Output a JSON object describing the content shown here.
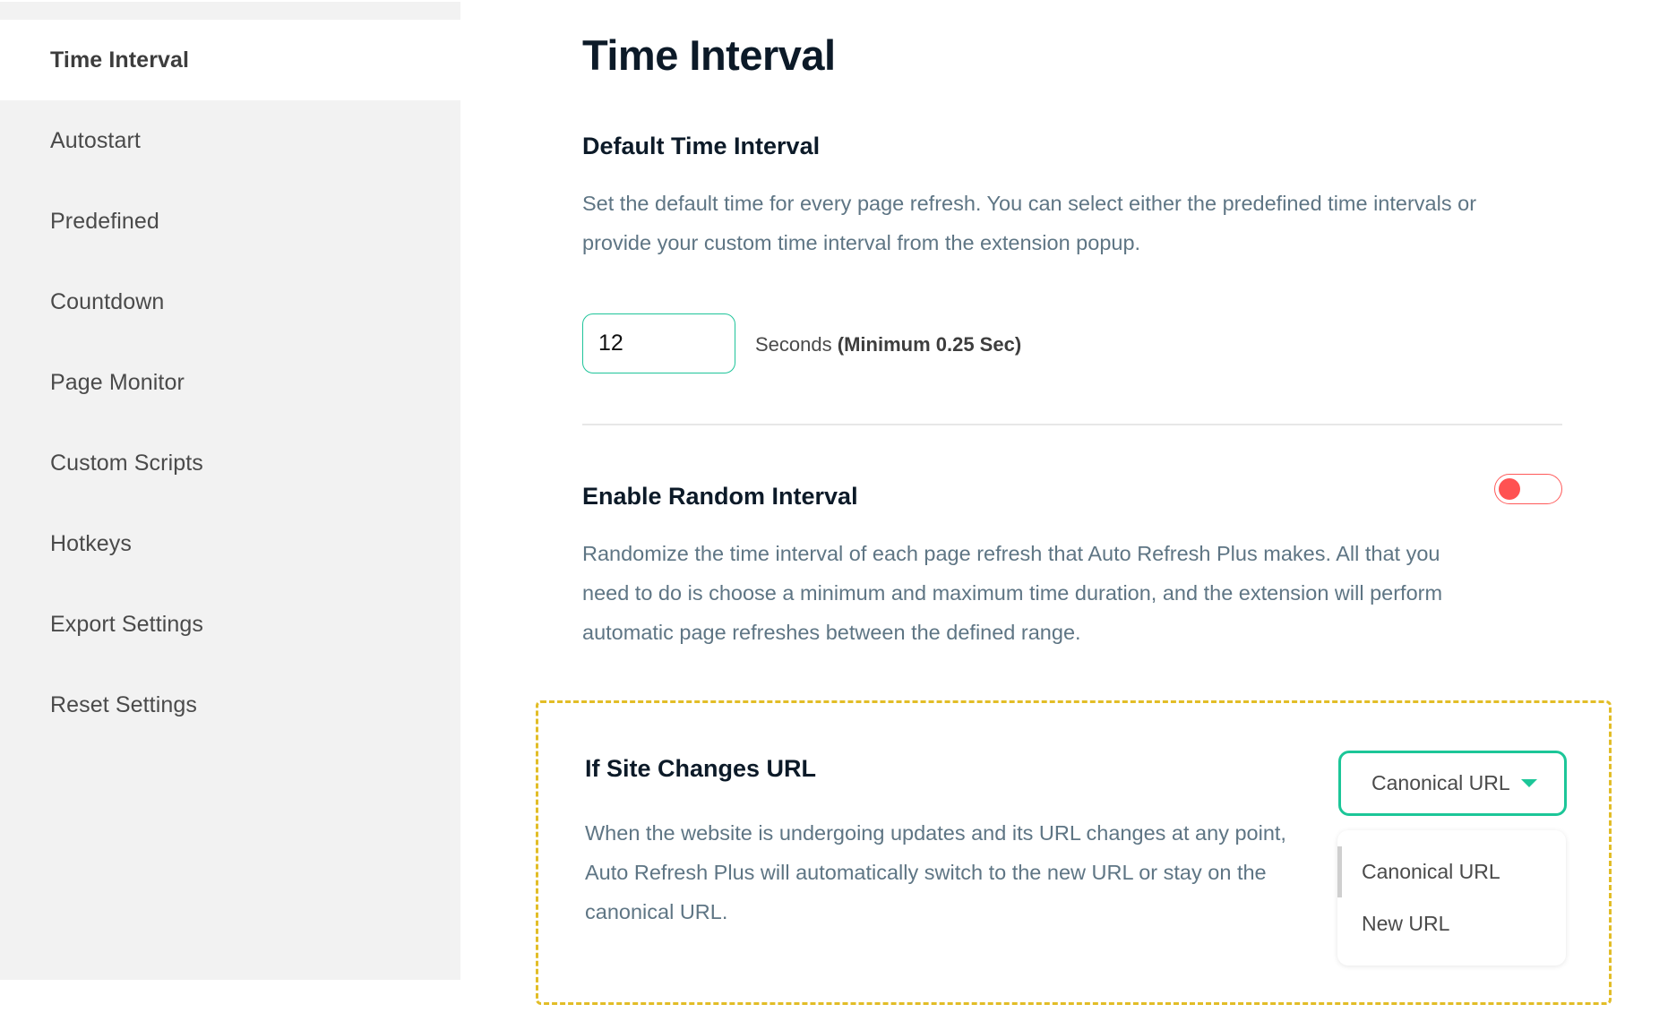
{
  "sidebar": {
    "items": [
      {
        "label": "Time Interval",
        "active": true
      },
      {
        "label": "Autostart",
        "active": false
      },
      {
        "label": "Predefined",
        "active": false
      },
      {
        "label": "Countdown",
        "active": false
      },
      {
        "label": "Page Monitor",
        "active": false
      },
      {
        "label": "Custom Scripts",
        "active": false
      },
      {
        "label": "Hotkeys",
        "active": false
      },
      {
        "label": "Export Settings",
        "active": false
      },
      {
        "label": "Reset Settings",
        "active": false
      }
    ]
  },
  "main": {
    "title": "Time Interval",
    "default_interval": {
      "heading": "Default Time Interval",
      "description": "Set the default time for every page refresh. You can select either the predefined time intervals or provide your custom time interval from the extension popup.",
      "input_value": "12",
      "unit_label": "Seconds",
      "unit_note": "(Minimum 0.25 Sec)"
    },
    "random_interval": {
      "heading": "Enable Random Interval",
      "description": "Randomize the time interval of each page refresh that Auto Refresh Plus makes. All that you need to do is choose a minimum and maximum time duration, and the extension will perform automatic page refreshes between the defined range.",
      "toggle_enabled": false
    },
    "site_changes_url": {
      "heading": "If Site Changes URL",
      "description": "When the website is undergoing updates and its URL changes at any point, Auto Refresh Plus will automatically switch to the new URL or stay on the canonical URL.",
      "selected": "Canonical URL",
      "options": [
        "Canonical URL",
        "New URL"
      ]
    }
  },
  "colors": {
    "accent": "#1cc698",
    "toggle_off": "#ff5252",
    "highlight_dashed": "#e2bd27",
    "sidebar_bg": "#f2f2f2"
  }
}
